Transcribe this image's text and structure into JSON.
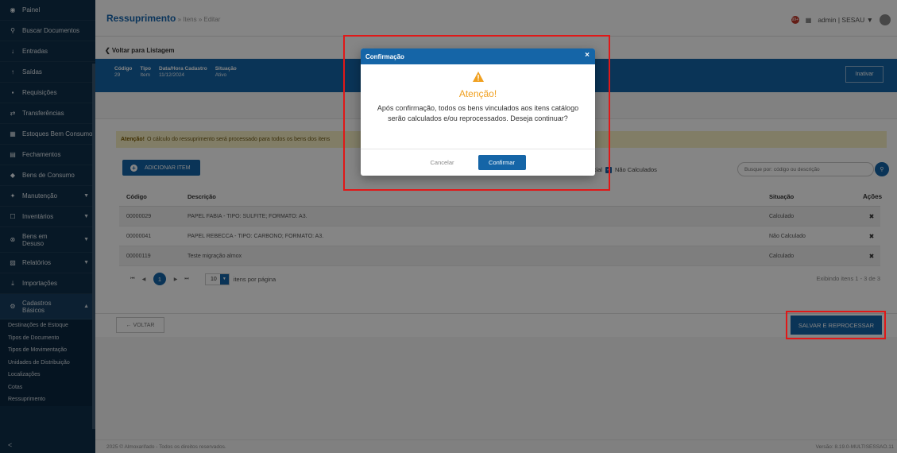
{
  "sidebar": {
    "items": [
      {
        "label": "Painel",
        "icon": "dashboard-icon"
      },
      {
        "label": "Buscar Documentos",
        "icon": "search-icon"
      },
      {
        "label": "Entradas",
        "icon": "arrow-down-icon"
      },
      {
        "label": "Saídas",
        "icon": "arrow-up-icon"
      },
      {
        "label": "Requisições",
        "icon": "file-icon"
      },
      {
        "label": "Transferências",
        "icon": "transfer-icon"
      },
      {
        "label": "Estoques Bem Consumo",
        "icon": "stock-icon"
      },
      {
        "label": "Fechamentos",
        "icon": "calendar-icon"
      },
      {
        "label": "Bens de Consumo",
        "icon": "tag-icon"
      },
      {
        "label": "Manutenção",
        "icon": "wrench-icon"
      },
      {
        "label": "Inventários",
        "icon": "inventory-icon"
      },
      {
        "label": "Bens em Desuso",
        "icon": "archive-icon"
      },
      {
        "label": "Relatórios",
        "icon": "report-icon"
      },
      {
        "label": "Importações",
        "icon": "import-icon"
      },
      {
        "label": "Cadastros Básicos",
        "icon": "gear-icon"
      }
    ],
    "subitems": [
      "Destinações de Estoque",
      "Tipos de Documento",
      "Tipos de Movimentação",
      "Unidades de Distribuição",
      "Localizações",
      "Cotas",
      "Ressuprimento"
    ],
    "collapse": "<"
  },
  "header": {
    "module": "Ressuprimento",
    "crumbs": " » Itens » Editar",
    "notif_count": "99+",
    "user": "admin | SESAU ▼"
  },
  "back_link": "❮ Voltar para Listagem",
  "info": {
    "cols": [
      {
        "h": "Código",
        "v": "29"
      },
      {
        "h": "Tipo",
        "v": "Item"
      },
      {
        "h": "Data/Hora Cadastro",
        "v": "11/12/2024"
      },
      {
        "h": "Situação",
        "v": "Ativo"
      }
    ],
    "inativar": "Inativar"
  },
  "warning": {
    "bold": "Atenção!",
    "text": "O cálculo do ressuprimento será processado para todos os bens dos itens"
  },
  "toolbar": {
    "add_item": "ADICIONAR ITEM",
    "filter_prefix": "arcial",
    "filter_label": "Não Calculados",
    "search_placeholder": "Busque por: código ou descrição"
  },
  "table": {
    "headers": {
      "code": "Código",
      "desc": "Descrição",
      "status": "Situação",
      "actions": "Ações"
    },
    "rows": [
      {
        "code": "00000029",
        "desc": "PAPEL FABIA - TIPO: SULFITE; FORMATO: A3.",
        "status": "Calculado"
      },
      {
        "code": "00000041",
        "desc": "PAPEL REBECCA - TIPO: CARBONO; FORMATO: A3.",
        "status": "Não Calculado"
      },
      {
        "code": "00000119",
        "desc": "Teste migração almox",
        "status": "Calculado"
      }
    ]
  },
  "pager": {
    "current": "1",
    "page_size": "10",
    "per_page_label": "itens por página",
    "info": "Exibindo itens 1 - 3 de 3"
  },
  "actions": {
    "voltar": "← VOLTAR",
    "salvar": "SALVAR E REPROCESSAR"
  },
  "footer": {
    "left": "2025 © Almoxarifado - Todos os direitos reservados.",
    "right": "Versão: 8.19.0-MULTISESSAO.11"
  },
  "modal": {
    "title": "Confirmação",
    "heading": "Atenção!",
    "message": "Após confirmação, todos os bens vinculados aos itens catálogo serão calculados e/ou reprocessados. Deseja continuar?",
    "cancel": "Cancelar",
    "confirm": "Confirmar"
  },
  "colors": {
    "primary": "#1565a7",
    "sidebar": "#0e2f4a",
    "warning_text": "#f0a020",
    "highlight": "#e01818"
  }
}
